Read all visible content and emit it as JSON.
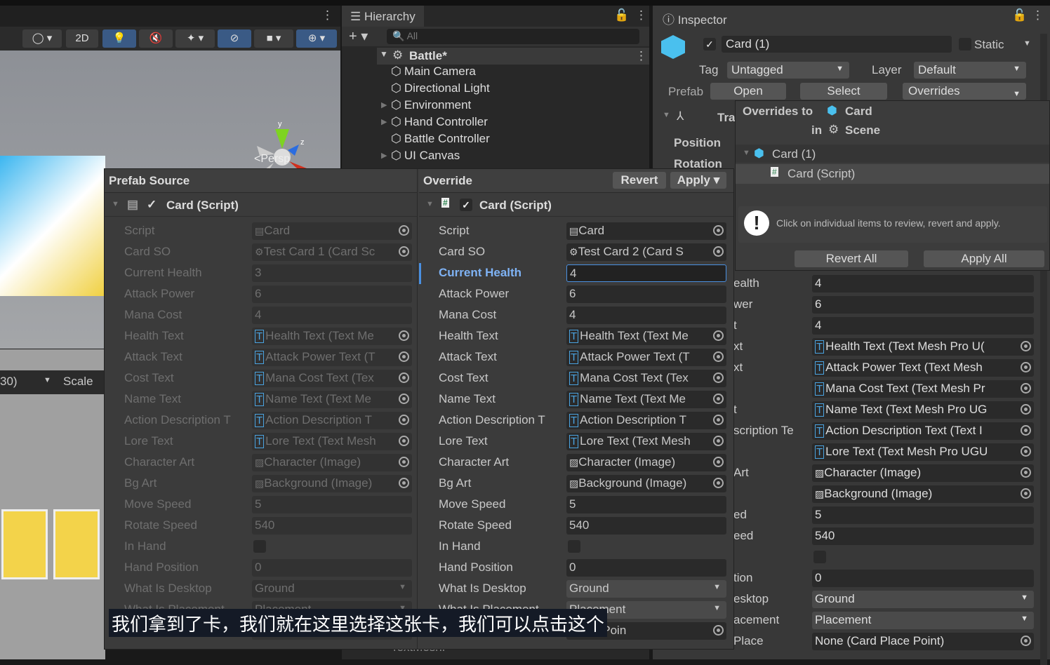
{
  "scene": {
    "toolbar": {
      "mode_2d": "2D"
    },
    "persp_label": "<Persp",
    "gizmo_axes": [
      "y",
      "z",
      "x"
    ],
    "bottom_dropdown": "30)",
    "scale_label": "Scale"
  },
  "hierarchy": {
    "tab": "Hierarchy",
    "search_placeholder": "All",
    "add_label": "+",
    "root": "Battle*",
    "items": [
      {
        "label": "Main Camera",
        "expandable": false
      },
      {
        "label": "Directional Light",
        "expandable": false
      },
      {
        "label": "Environment",
        "expandable": true
      },
      {
        "label": "Hand Controller",
        "expandable": true
      },
      {
        "label": "Battle Controller",
        "expandable": false
      },
      {
        "label": "UI Canvas",
        "expandable": true
      }
    ],
    "bottom_item": "TextMeshP"
  },
  "inspector": {
    "tab": "Inspector",
    "object_name": "Card (1)",
    "static_label": "Static",
    "tag_label": "Tag",
    "tag_value": "Untagged",
    "layer_label": "Layer",
    "layer_value": "Default",
    "prefab_label": "Prefab",
    "open": "Open",
    "select": "Select",
    "overrides": "Overrides",
    "transform_label": "Tra",
    "position_label": "Position",
    "rotation_label": "Rotation",
    "rows": [
      {
        "label": "ealth",
        "value": "4"
      },
      {
        "label": "wer",
        "value": "6"
      },
      {
        "label": "t",
        "value": "4"
      },
      {
        "label": "xt",
        "value": "Health Text (Text Mesh Pro U(",
        "ref": "text"
      },
      {
        "label": "xt",
        "value": "Attack Power Text (Text Mesh",
        "ref": "text"
      },
      {
        "label": "",
        "value": "Mana Cost Text (Text Mesh Pr",
        "ref": "text"
      },
      {
        "label": "t",
        "value": "Name Text (Text Mesh Pro UG",
        "ref": "text"
      },
      {
        "label": "scription Te",
        "value": "Action Description Text (Text I",
        "ref": "text"
      },
      {
        "label": "",
        "value": "Lore Text (Text Mesh Pro UGU",
        "ref": "text"
      },
      {
        "label": "Art",
        "value": "Character (Image)",
        "ref": "image"
      },
      {
        "label": "",
        "value": "Background (Image)",
        "ref": "image"
      },
      {
        "label": "ed",
        "value": "5"
      },
      {
        "label": "eed",
        "value": "540"
      },
      {
        "label": "",
        "value": "",
        "checkbox": true
      },
      {
        "label": "tion",
        "value": "0"
      },
      {
        "label": "esktop",
        "value": "Ground",
        "dropdown": true
      },
      {
        "label": "acement",
        "value": "Placement",
        "dropdown": true
      },
      {
        "label": "Place",
        "value": "None (Card Place Point)",
        "ref": "obj"
      }
    ]
  },
  "overrides_popup": {
    "title_prefix": "Overrides to",
    "prefab": "Card",
    "in_label": "in",
    "scene": "Scene",
    "tree_root": "Card (1)",
    "tree_child": "Card (Script)",
    "info": "Click on individual items to review, revert and apply.",
    "revert_all": "Revert All",
    "apply_all": "Apply All"
  },
  "comparison": {
    "left_header": "Prefab Source",
    "right_header": "Override",
    "revert": "Revert",
    "apply": "Apply",
    "component": "Card (Script)",
    "labels": [
      "Script",
      "Card SO",
      "Current Health",
      "Attack Power",
      "Mana Cost",
      "Health Text",
      "Attack Text",
      "Cost Text",
      "Name Text",
      "Action Description T",
      "Lore Text",
      "Character Art",
      "Bg Art",
      "Move Speed",
      "Rotate Speed",
      "In Hand",
      "Hand Position",
      "What Is Desktop",
      "What Is Placement",
      ""
    ],
    "left_values": [
      "Card",
      "Test Card 1 (Card Sc",
      "3",
      "6",
      "4",
      "Health Text (Text Me",
      "Attack Power Text (T",
      "Mana Cost Text (Tex",
      "Name Text (Text Me",
      "Action Description T",
      "Lore Text (Text Mesh",
      "Character (Image)",
      "Background (Image)",
      "5",
      "540",
      "",
      "0",
      "Ground",
      "Placement",
      ""
    ],
    "right_values": [
      "Card",
      "Test Card 2 (Card S",
      "4",
      "6",
      "4",
      "Health Text (Text Me",
      "Attack Power Text (T",
      "Mana Cost Text (Tex",
      "Name Text (Text Me",
      "Action Description T",
      "Lore Text (Text Mesh",
      "Character (Image)",
      "Background (Image)",
      "5",
      "540",
      "",
      "0",
      "Ground",
      "Placement",
      "Place Poin"
    ],
    "kinds": [
      "script",
      "obj",
      "num",
      "num",
      "num",
      "text",
      "text",
      "text",
      "text",
      "text",
      "text",
      "image",
      "image",
      "num",
      "num",
      "check",
      "num",
      "dd",
      "dd",
      "obj"
    ],
    "highlighted_row": "Current Health"
  },
  "subtitle": "我们拿到了卡，我们就在这里选择这张卡，我们可以点击这个",
  "colors": {
    "accent": "#3a5a85",
    "highlight_label": "#7fb3f5",
    "panel": "#383838",
    "field": "#2a2a2a"
  }
}
